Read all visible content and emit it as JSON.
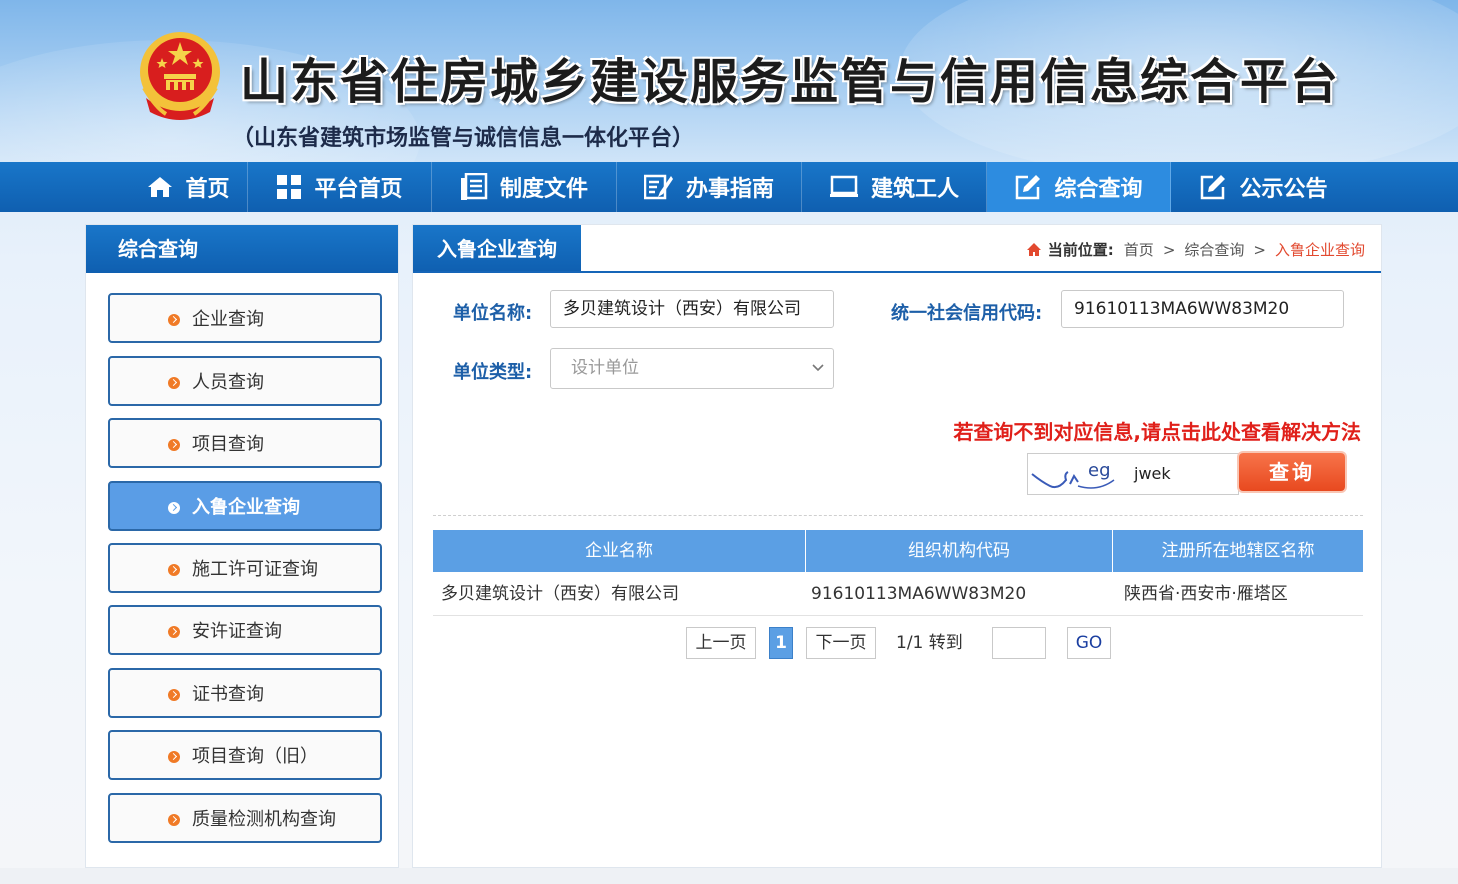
{
  "header": {
    "title": "山东省住房城乡建设服务监管与信用信息综合平台",
    "subtitle": "（山东省建筑市场监管与诚信信息一体化平台）"
  },
  "nav": {
    "items": [
      {
        "label": "首页",
        "icon": "home-icon"
      },
      {
        "label": "平台首页",
        "icon": "grid-icon"
      },
      {
        "label": "制度文件",
        "icon": "document-icon"
      },
      {
        "label": "办事指南",
        "icon": "guide-icon"
      },
      {
        "label": "建筑工人",
        "icon": "monitor-icon"
      },
      {
        "label": "综合查询",
        "icon": "edit-icon",
        "active": true
      },
      {
        "label": "公示公告",
        "icon": "edit-icon"
      }
    ]
  },
  "sidebar": {
    "title": "综合查询",
    "items": [
      {
        "label": "企业查询"
      },
      {
        "label": "人员查询"
      },
      {
        "label": "项目查询"
      },
      {
        "label": "入鲁企业查询",
        "active": true
      },
      {
        "label": "施工许可证查询"
      },
      {
        "label": "安许证查询"
      },
      {
        "label": "证书查询"
      },
      {
        "label": "项目查询（旧）"
      },
      {
        "label": "质量检测机构查询"
      }
    ]
  },
  "main": {
    "tab_title": "入鲁企业查询",
    "breadcrumb": {
      "label": "当前位置:",
      "items": [
        "首页",
        "综合查询",
        "入鲁企业查询"
      ],
      "separator": ">"
    },
    "form": {
      "unit_name_label": "单位名称:",
      "unit_name_value": "多贝建筑设计（西安）有限公司",
      "credit_code_label": "统一社会信用代码:",
      "credit_code_value": "91610113MA6WW83M20",
      "unit_type_label": "单位类型:",
      "unit_type_value": "设计单位"
    },
    "hint": "若查询不到对应信息,请点击此处查看解决方法",
    "captcha": {
      "image_text": "eg",
      "input_value": "jwek"
    },
    "query_button": "查询",
    "table": {
      "columns": [
        "企业名称",
        "组织机构代码",
        "注册所在地辖区名称"
      ],
      "rows": [
        [
          "多贝建筑设计（西安）有限公司",
          "91610113MA6WW83M20",
          "陕西省·西安市·雁塔区"
        ]
      ]
    },
    "pager": {
      "prev": "上一页",
      "current_page": "1",
      "next": "下一页",
      "page_info": "1/1 转到",
      "goto_value": "",
      "go": "GO"
    }
  },
  "colors": {
    "nav_blue": "#1565b8",
    "active_blue": "#5b9fe4",
    "accent_orange": "#f07a26",
    "hint_red": "#e0201a"
  }
}
